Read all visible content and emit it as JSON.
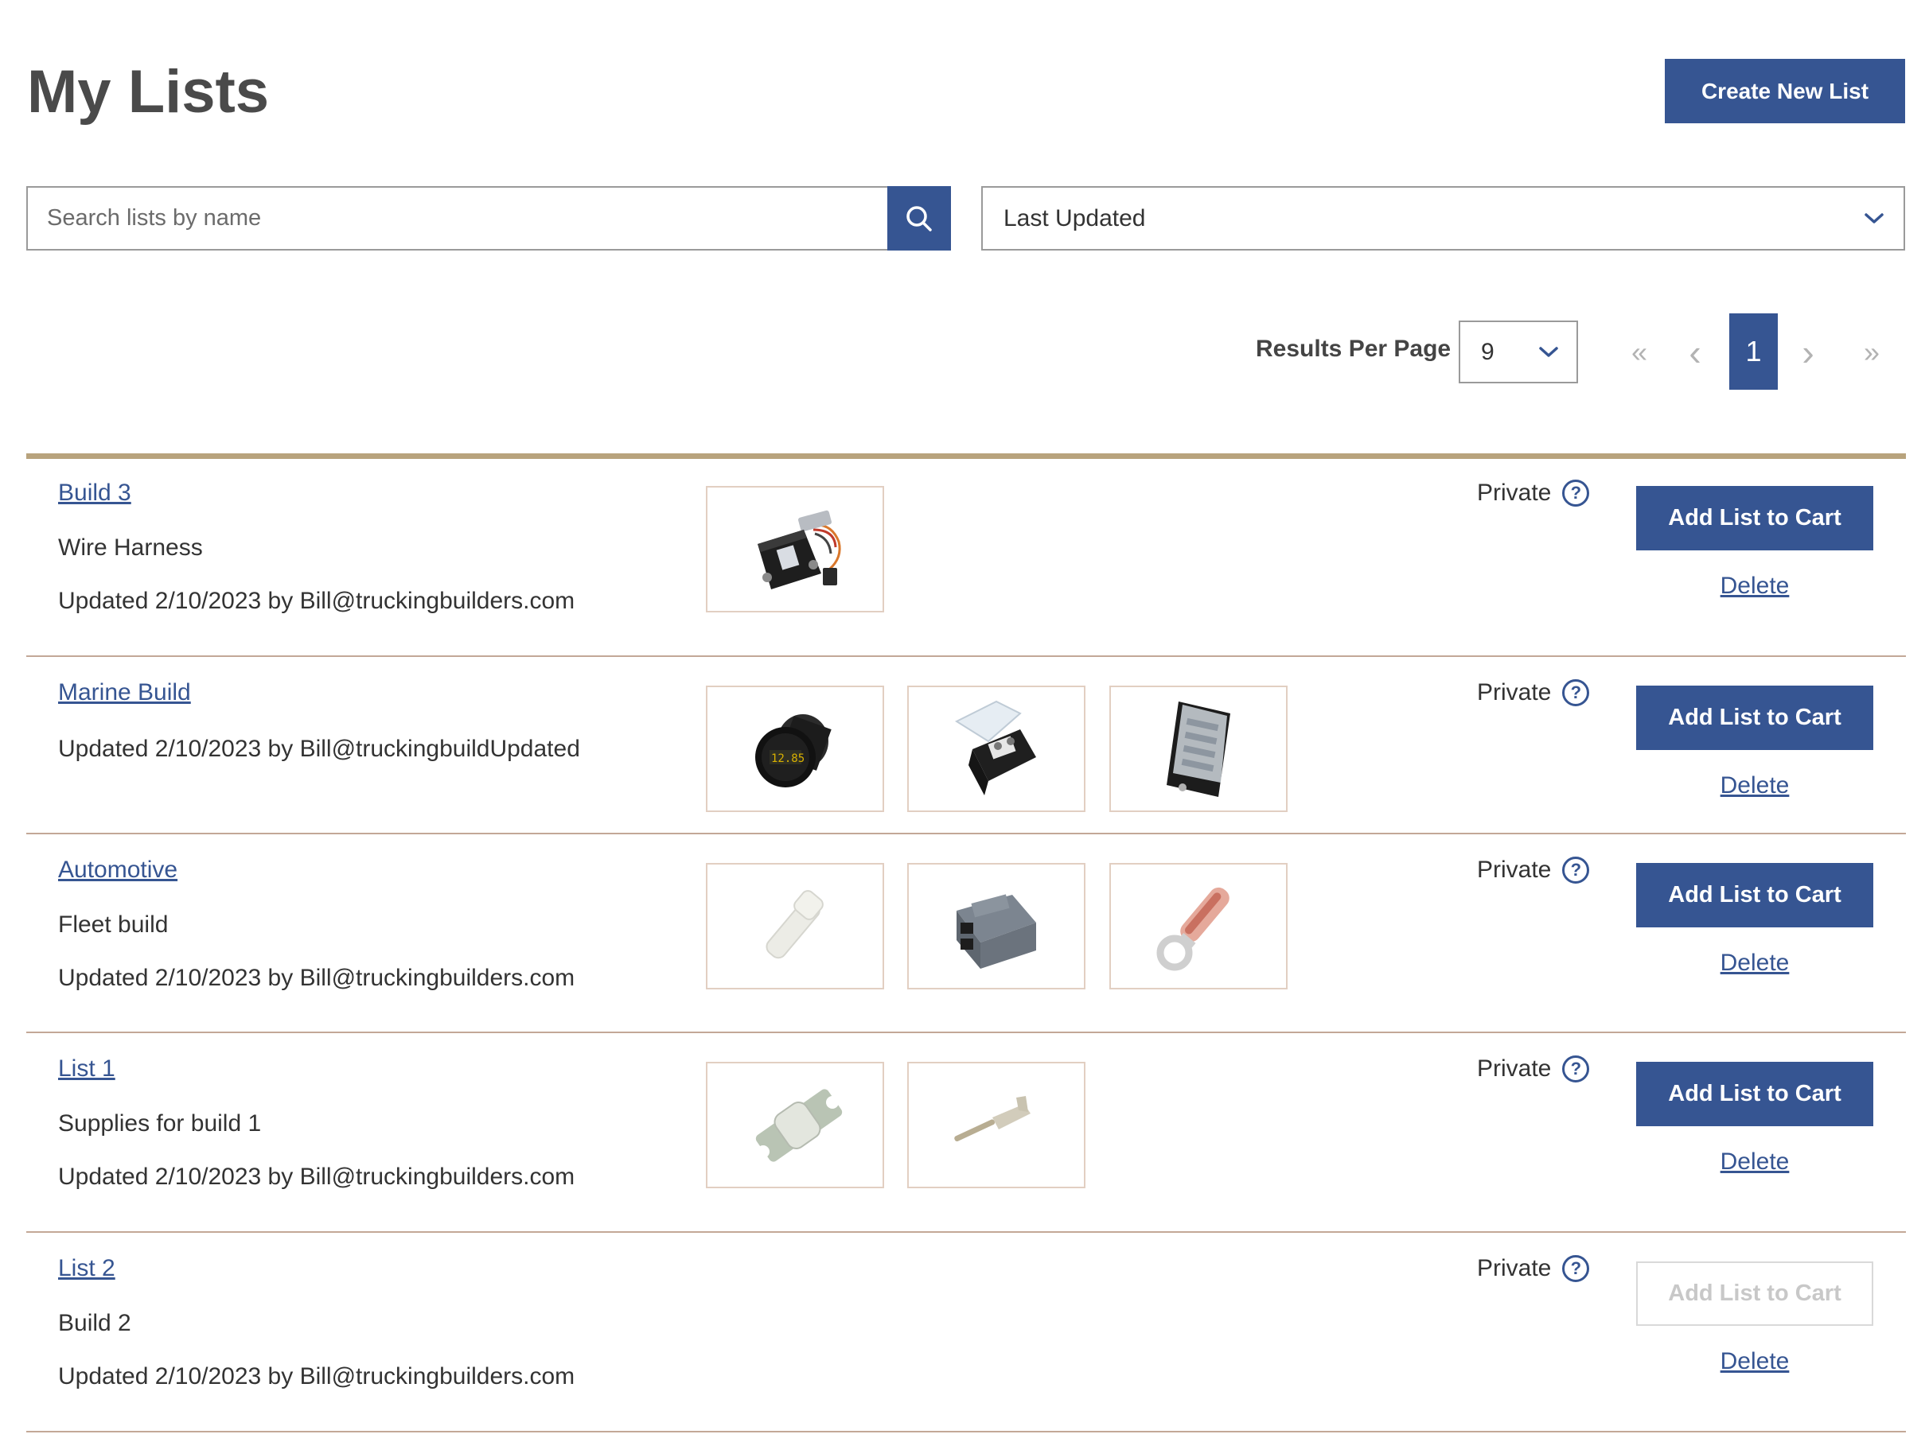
{
  "header": {
    "title": "My Lists",
    "create_button": "Create New List"
  },
  "search": {
    "placeholder": "Search lists by name",
    "value": ""
  },
  "sort": {
    "selected": "Last Updated"
  },
  "pagination": {
    "results_per_page_label": "Results Per Page",
    "results_per_page_value": "9",
    "current_page": "1",
    "first_glyph": "«",
    "prev_glyph": "‹",
    "next_glyph": "›",
    "last_glyph": "»"
  },
  "lists": [
    {
      "name": "Build 3",
      "description": "Wire Harness",
      "updated": "Updated 2/10/2023 by Bill@truckingbuilders.com",
      "privacy": "Private",
      "add_to_cart": "Add List to Cart",
      "add_enabled": true,
      "delete": "Delete",
      "thumbnails": [
        "battery-monitor-module-icon"
      ]
    },
    {
      "name": "Marine Build",
      "description": "",
      "updated": "Updated 2/10/2023 by Bill@truckingbuildUpdated",
      "privacy": "Private",
      "add_to_cart": "Add List to Cart",
      "add_enabled": true,
      "delete": "Delete",
      "thumbnails": [
        "round-voltmeter-gauge-icon",
        "fuse-holder-with-cover-icon",
        "fuse-block-icon"
      ]
    },
    {
      "name": "Automotive",
      "description": "Fleet build",
      "updated": "Updated 2/10/2023 by Bill@truckingbuilders.com",
      "privacy": "Private",
      "add_to_cart": "Add List to Cart",
      "add_enabled": true,
      "delete": "Delete",
      "thumbnails": [
        "wedge-seal-plug-icon",
        "connector-housing-icon",
        "ring-terminal-icon"
      ]
    },
    {
      "name": "List 1",
      "description": "Supplies for build 1",
      "updated": "Updated 2/10/2023 by Bill@truckingbuilders.com",
      "privacy": "Private",
      "add_to_cart": "Add List to Cart",
      "add_enabled": true,
      "delete": "Delete",
      "thumbnails": [
        "bolt-down-fuse-icon",
        "pin-contact-icon"
      ]
    },
    {
      "name": "List 2",
      "description": "Build 2",
      "updated": "Updated 2/10/2023 by Bill@truckingbuilders.com",
      "privacy": "Private",
      "add_to_cart": "Add List to Cart",
      "add_enabled": false,
      "delete": "Delete",
      "thumbnails": []
    }
  ],
  "colors": {
    "primary": "#365592",
    "rule": "#b8a37d",
    "row_divider": "#c3a897"
  }
}
